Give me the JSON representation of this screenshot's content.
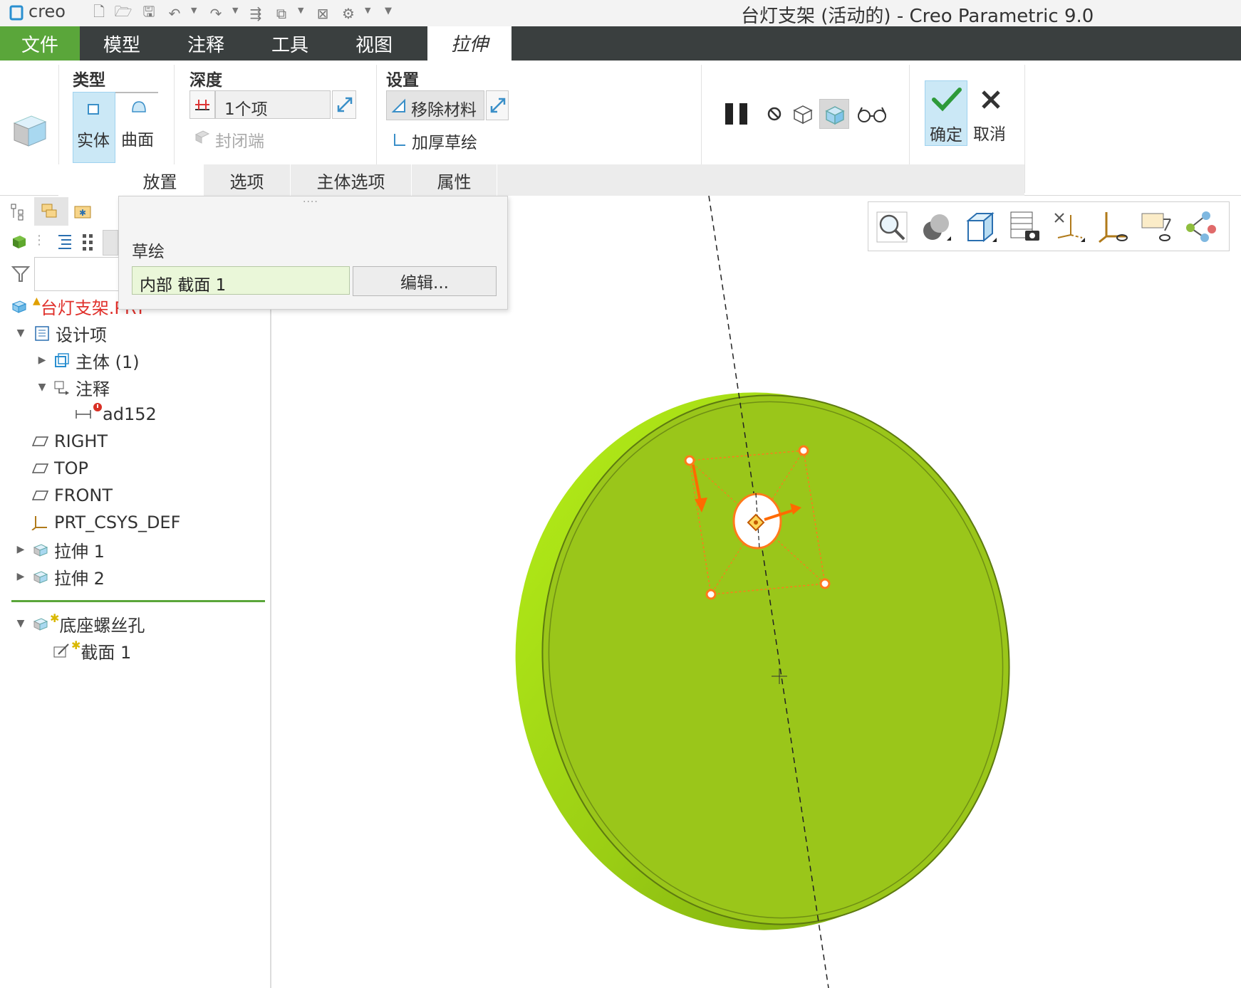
{
  "titlebar": {
    "logo": "creo",
    "window_title": "台灯支架 (活动的) - Creo Parametric 9.0"
  },
  "tabs": [
    {
      "label": "文件"
    },
    {
      "label": "模型"
    },
    {
      "label": "注释"
    },
    {
      "label": "工具"
    },
    {
      "label": "视图"
    },
    {
      "label": "拉伸"
    }
  ],
  "ribbon": {
    "type": {
      "title": "类型",
      "solid": "实体",
      "surface": "曲面"
    },
    "depth": {
      "title": "深度",
      "value": "1个项",
      "capped_ends": "封闭端"
    },
    "settings": {
      "title": "设置",
      "remove_material": "移除材料",
      "thicken_sketch": "加厚草绘"
    },
    "actions": {
      "ok": "确定",
      "cancel": "取消"
    }
  },
  "subtabs": [
    {
      "label": "放置"
    },
    {
      "label": "选项"
    },
    {
      "label": "主体选项"
    },
    {
      "label": "属性"
    }
  ],
  "popup": {
    "grip": "····",
    "section_label": "草绘",
    "sketch_value": "内部 截面 1",
    "edit_button": "编辑..."
  },
  "tree": {
    "root": "台灯支架.PRT",
    "design_items": "设计项",
    "body": "主体 (1)",
    "annotations": "注释",
    "annotation_item": "ad152",
    "right": "RIGHT",
    "top": "TOP",
    "front": "FRONT",
    "csys": "PRT_CSYS_DEF",
    "extrude1": "拉伸 1",
    "extrude2": "拉伸 2",
    "active_feature": "底座螺丝孔",
    "section": "截面 1"
  },
  "colors": {
    "accent_green": "#5aa63a",
    "model_green": "#9ac61a",
    "error_red": "#d93025",
    "highlight_orange": "#ff7a1a",
    "selection_blue": "#cbe8f6"
  }
}
